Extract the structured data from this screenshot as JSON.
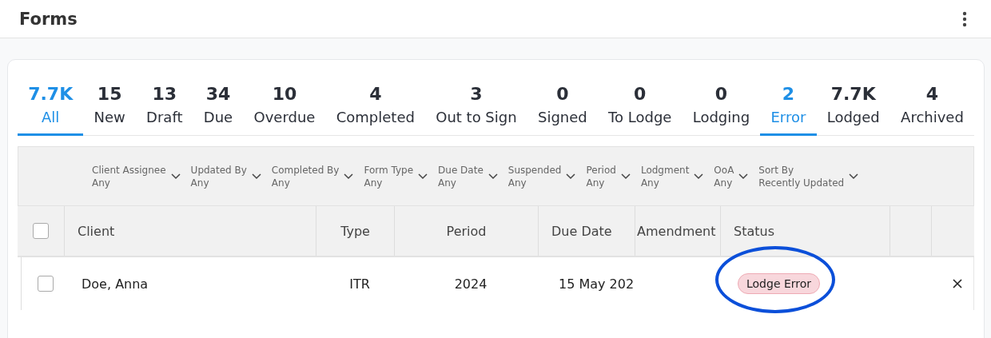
{
  "header": {
    "title": "Forms"
  },
  "tabs": [
    {
      "count": "7.7K",
      "label": "All",
      "selected": true
    },
    {
      "count": "15",
      "label": "New",
      "selected": false
    },
    {
      "count": "13",
      "label": "Draft",
      "selected": false
    },
    {
      "count": "34",
      "label": "Due",
      "selected": false
    },
    {
      "count": "10",
      "label": "Overdue",
      "selected": false
    },
    {
      "count": "4",
      "label": "Completed",
      "selected": false
    },
    {
      "count": "3",
      "label": "Out to Sign",
      "selected": false
    },
    {
      "count": "0",
      "label": "Signed",
      "selected": false
    },
    {
      "count": "0",
      "label": "To Lodge",
      "selected": false
    },
    {
      "count": "0",
      "label": "Lodging",
      "selected": false
    },
    {
      "count": "2",
      "label": "Error",
      "selected": true
    },
    {
      "count": "7.7K",
      "label": "Lodged",
      "selected": false
    },
    {
      "count": "4",
      "label": "Archived",
      "selected": false
    }
  ],
  "filters": [
    {
      "label": "Client Assignee",
      "value": "Any"
    },
    {
      "label": "Updated By",
      "value": "Any"
    },
    {
      "label": "Completed By",
      "value": "Any"
    },
    {
      "label": "Form Type",
      "value": "Any"
    },
    {
      "label": "Due Date",
      "value": "Any"
    },
    {
      "label": "Suspended",
      "value": "Any"
    },
    {
      "label": "Period",
      "value": "Any"
    },
    {
      "label": "Lodgment",
      "value": "Any"
    },
    {
      "label": "OoA",
      "value": "Any"
    },
    {
      "label": "Sort By",
      "value": "Recently Updated"
    }
  ],
  "table": {
    "select_all": {
      "checked": false
    },
    "columns": [
      "Client",
      "Type",
      "Period",
      "Due Date",
      "Amendment",
      "Status"
    ],
    "rows": [
      {
        "checked": false,
        "client": "Doe, Anna",
        "type": "ITR",
        "period": "2024",
        "due_date": "15 May 202",
        "status": "Lodge Error",
        "highlighted": true
      }
    ]
  }
}
